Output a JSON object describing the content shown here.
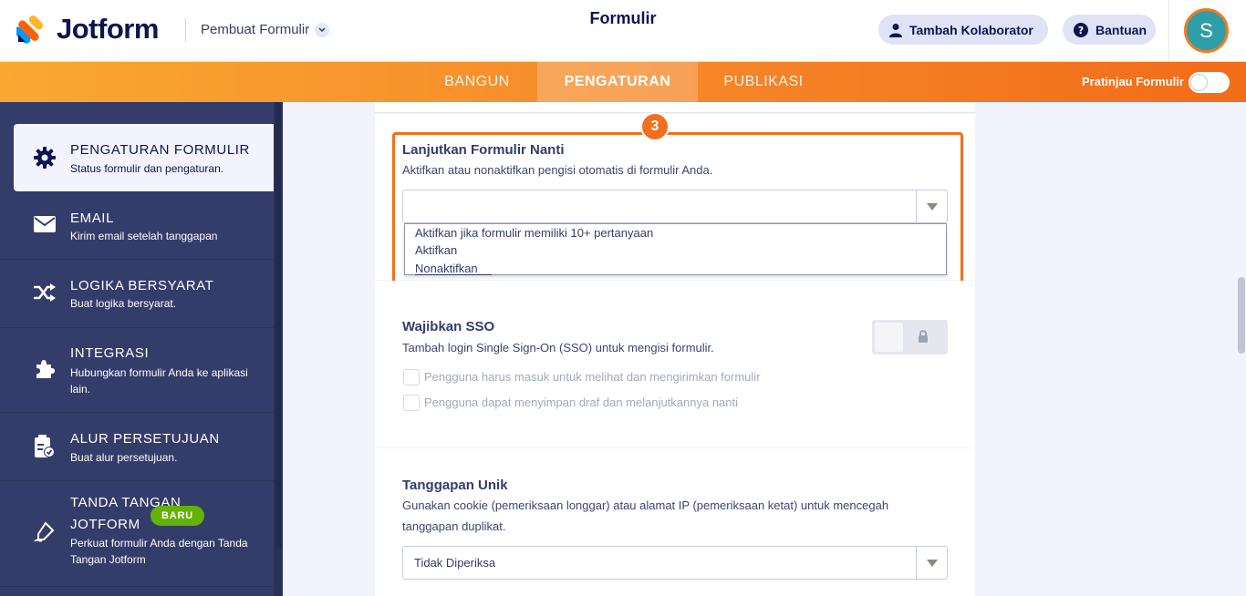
{
  "header": {
    "logo_text": "Jotform",
    "builder_menu": "Pembuat Formulir",
    "form_title": "Formulir",
    "collab_label": "Tambah Kolaborator",
    "help_label": "Bantuan",
    "avatar_initial": "S"
  },
  "nav": {
    "tabs": [
      {
        "label": "BANGUN"
      },
      {
        "label": "PENGATURAN"
      },
      {
        "label": "PUBLIKASI"
      }
    ],
    "preview_label": "Pratinjau Formulir"
  },
  "sidebar": {
    "items": [
      {
        "title": "PENGATURAN FORMULIR",
        "subtitle": "Status formulir dan pengaturan.",
        "icon": "gear-icon"
      },
      {
        "title": "EMAIL",
        "subtitle": "Kirim email setelah tanggapan",
        "icon": "envelope-icon"
      },
      {
        "title": "LOGIKA BERSYARAT",
        "subtitle": "Buat logika bersyarat.",
        "icon": "shuffle-icon"
      },
      {
        "title": "INTEGRASI",
        "subtitle": "Hubungkan formulir Anda ke aplikasi lain.",
        "icon": "puzzle-icon"
      },
      {
        "title": "ALUR PERSETUJUAN",
        "subtitle": "Buat alur persetujuan.",
        "icon": "approval-icon"
      },
      {
        "title_line1": "TANDA TANGAN",
        "title_line2": "JOTFORM",
        "subtitle": "Perkuat formulir Anda dengan Tanda Tangan Jotform",
        "icon": "signature-pen-icon",
        "badge": "BARU"
      }
    ]
  },
  "continue_later": {
    "step_number": "3",
    "title": "Lanjutkan Formulir Nanti",
    "description": "Aktifkan atau nonaktifkan pengisi otomatis di formulir Anda.",
    "selected_value": "",
    "options": [
      "Aktifkan jika formulir memiliki 10+ pertanyaan",
      "Aktifkan",
      "Nonaktifkan"
    ]
  },
  "sso": {
    "title": "Wajibkan SSO",
    "description": "Tambah login Single Sign-On (SSO) untuk mengisi formulir.",
    "checkboxes": [
      "Pengguna harus masuk untuk melihat dan mengirimkan formulir",
      "Pengguna dapat menyimpan draf dan melanjutkannya nanti"
    ]
  },
  "unique": {
    "title": "Tanggapan Unik",
    "description_line1": "Gunakan cookie (pemeriksaan longgar) atau alamat IP (pemeriksaan ketat) untuk mencegah",
    "description_line2": "tanggapan duplikat.",
    "selected_value": "Tidak Diperiksa"
  },
  "colors": {
    "brand_orange": "#f26c1a",
    "navy": "#0a1551",
    "sidebar_bg": "#343c6a",
    "badge_green": "#64b200"
  }
}
